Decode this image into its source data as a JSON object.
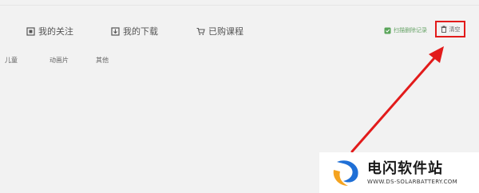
{
  "nav": {
    "follow": "我的关注",
    "download": "我的下载",
    "courses": "已购课程"
  },
  "tools": {
    "history": "扫描删除记录",
    "clear": "清空"
  },
  "categories": [
    "儿童",
    "动画片",
    "其他"
  ],
  "watermark": {
    "title": "电闪软件站",
    "url": "WWW.DS-SOLARBATTERY.COM"
  },
  "colors": {
    "highlight_box": "#e21b1b",
    "arrow": "#e21b1b",
    "history_icon": "#5aa55a",
    "logo_blue": "#1f6fd6",
    "logo_orange": "#f4a320"
  }
}
